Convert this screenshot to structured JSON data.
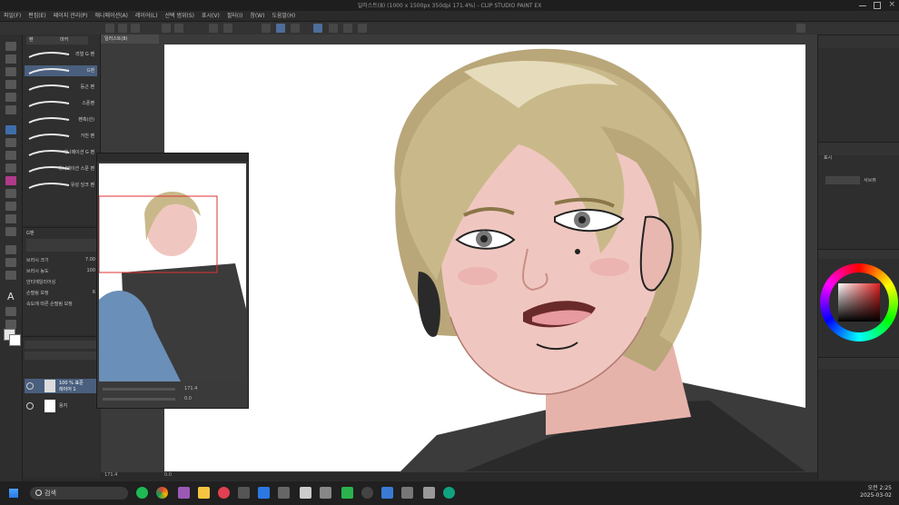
{
  "window": {
    "title": "일러스트(8) (1000 x 1500px 350dpi 171.4%) - CLIP STUDIO PAINT EX"
  },
  "menu": [
    "파일(F)",
    "편집(E)",
    "페이지 관리(P)",
    "애니메이션(A)",
    "레이어(L)",
    "선택 범위(S)",
    "표시(V)",
    "필터(I)",
    "창(W)",
    "도움말(H)"
  ],
  "document_tab": "일러스트(8)",
  "brush_panel": {
    "tabs": [
      "펜",
      "마커"
    ],
    "brushes": [
      "리얼 G 펜",
      "G펜",
      "둥근 펜",
      "스푼펜",
      "펜촉(산)",
      "거친 펜",
      "애니메이션 G 펜",
      "애니메이션 스푼 펜",
      "유성 잉크 펜"
    ],
    "selected_index": 1
  },
  "tool_property": {
    "brush_name": "G펜",
    "rows": [
      {
        "label": "브러시 크기",
        "value": "7.00"
      },
      {
        "label": "브러시 농도",
        "value": "100"
      },
      {
        "label": "안티에일리어싱",
        "value": ""
      },
      {
        "label": "손떨림 보정",
        "value": "6"
      },
      {
        "label": "속도에 따른 손떨림 보정",
        "value": ""
      }
    ]
  },
  "layer_panel": {
    "layers": [
      {
        "name": "100 % 표준",
        "sub": "레이어 1"
      },
      {
        "name": "용지",
        "sub": ""
      }
    ]
  },
  "navigator": {
    "zoom": "171.4",
    "angle": "0.0"
  },
  "status": {
    "zoom": "171.4",
    "position": "0.0"
  },
  "right_panel": {
    "color_label": "표시",
    "subview_label": "서브뷰"
  },
  "taskbar": {
    "search_placeholder": "검색",
    "time": "오전 2:25",
    "date": "2025-03-02"
  },
  "colors": {
    "accent": "#3e6ea8",
    "hair": "#c9b98a",
    "skin": "#f0c7c0",
    "shirt": "#3b3b3b"
  }
}
